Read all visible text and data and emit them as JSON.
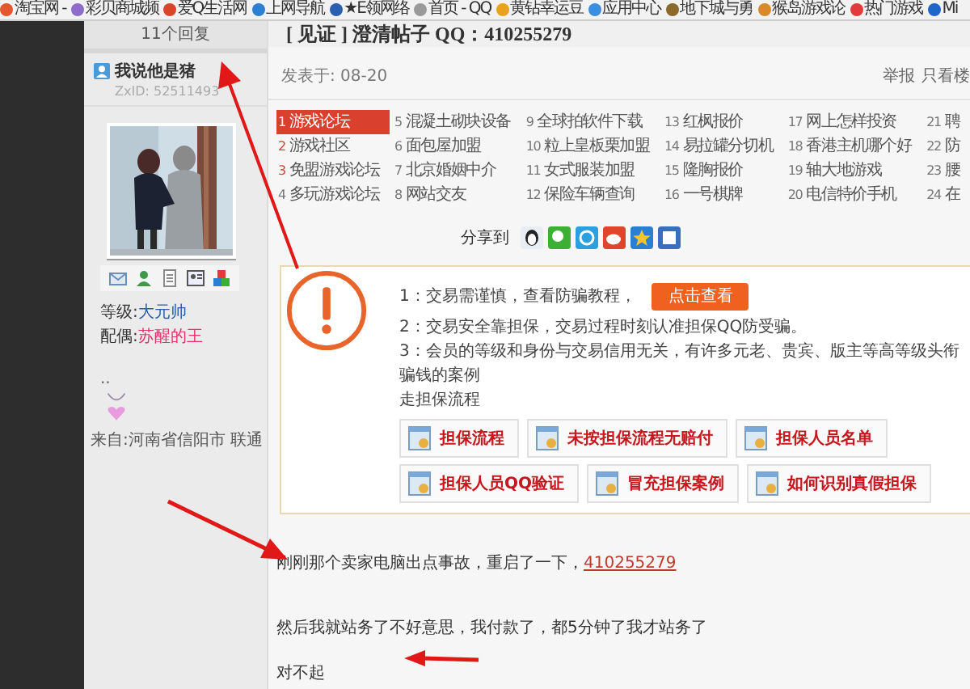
{
  "bookmarks": [
    {
      "label": "淘宝网 -",
      "color": "#e4572e"
    },
    {
      "label": "彩贝商城频",
      "color": "#8e6cc9"
    },
    {
      "label": "爱Q生活网",
      "color": "#d9452b"
    },
    {
      "label": "上网导航",
      "color": "#2d7fd3"
    },
    {
      "label": "★E领网络",
      "color": "#2b5fb0"
    },
    {
      "label": "首页 - QQ",
      "color": "#9a9a9a"
    },
    {
      "label": "黄钻幸运豆",
      "color": "#e8a21c"
    },
    {
      "label": "应用中心",
      "color": "#3a8de0"
    },
    {
      "label": "地下城与勇",
      "color": "#8a6a2a"
    },
    {
      "label": "猴岛游戏论",
      "color": "#d88a2a"
    },
    {
      "label": "热门游戏",
      "color": "#e23b3b"
    },
    {
      "label": "Mi",
      "color": "#2066c8"
    }
  ],
  "sidebar": {
    "reply_count": "11个回复",
    "username": "我说他是猪",
    "user_id": "ZxID: 52511493",
    "fields": [
      {
        "label": "等级:",
        "value": "大元帅",
        "color": "#2a5caa"
      },
      {
        "label": "配偶:",
        "value": "苏醒的王",
        "color": "#e0336f"
      }
    ],
    "signature": "..",
    "location": "来自:河南省信阳市 联通"
  },
  "post": {
    "title": "[ 见证 ] 澄清帖子  QQ：410255279",
    "posted": "发表于: 08-20",
    "actions": [
      "举报",
      "只看楼"
    ],
    "ads": [
      {
        "number": "1",
        "text": "游戏论坛",
        "selected": true,
        "hot": true
      },
      {
        "number": "2",
        "text": "游戏社区",
        "selected": false,
        "hot": true
      },
      {
        "number": "3",
        "text": "免盟游戏论坛",
        "selected": false,
        "hot": true
      },
      {
        "number": "4",
        "text": "多玩游戏论坛",
        "selected": false,
        "hot": false
      },
      {
        "number": "5",
        "text": "混凝土砌块设备",
        "selected": false,
        "hot": false
      },
      {
        "number": "6",
        "text": "面包屋加盟",
        "selected": false,
        "hot": false
      },
      {
        "number": "7",
        "text": "北京婚姻中介",
        "selected": false,
        "hot": false
      },
      {
        "number": "8",
        "text": "网站交友",
        "selected": false,
        "hot": false
      },
      {
        "number": "9",
        "text": "全球拍软件下载",
        "selected": false,
        "hot": false
      },
      {
        "number": "10",
        "text": "粒上皇板栗加盟",
        "selected": false,
        "hot": false
      },
      {
        "number": "11",
        "text": "女式服装加盟",
        "selected": false,
        "hot": false
      },
      {
        "number": "12",
        "text": "保险车辆查询",
        "selected": false,
        "hot": false
      },
      {
        "number": "13",
        "text": "红枫报价",
        "selected": false,
        "hot": false
      },
      {
        "number": "14",
        "text": "易拉罐分切机",
        "selected": false,
        "hot": false
      },
      {
        "number": "15",
        "text": "隆胸报价",
        "selected": false,
        "hot": false
      },
      {
        "number": "16",
        "text": "一号棋牌",
        "selected": false,
        "hot": false
      },
      {
        "number": "17",
        "text": "网上怎样投资",
        "selected": false,
        "hot": false
      },
      {
        "number": "18",
        "text": "香港主机哪个好",
        "selected": false,
        "hot": false
      },
      {
        "number": "19",
        "text": "轴大地游戏",
        "selected": false,
        "hot": false
      },
      {
        "number": "20",
        "text": "电信特价手机",
        "selected": false,
        "hot": false
      },
      {
        "number": "21",
        "text": "聘",
        "selected": false,
        "hot": false
      },
      {
        "number": "22",
        "text": "防",
        "selected": false,
        "hot": false
      },
      {
        "number": "23",
        "text": "腰",
        "selected": false,
        "hot": false
      },
      {
        "number": "24",
        "text": "在",
        "selected": false,
        "hot": false
      }
    ],
    "share_label": "分享到",
    "notice": {
      "lines": [
        "1：交易需谨慎，查看防骗教程，",
        "2：交易安全靠担保，交易过程时刻认准担保QQ防受骗。",
        "3：会员的等级和身份与交易信用无关，有许多元老、贵宾、版主等高等级头衔骗钱的案例",
        "走担保流程"
      ],
      "button": "点击查看",
      "links": [
        "担保流程",
        "未按担保流程无赔付",
        "担保人员名单",
        "担保人员QQ验证",
        "冒充担保案例",
        "如何识别真假担保"
      ]
    },
    "body": [
      {
        "text": "刚刚那个卖家电脑出点事故，重启了一下，",
        "link": "410255279"
      },
      {
        "text": "然后我就站务了不好意思，我付款了，都5分钟了我才站务了"
      },
      {
        "text": "对不起"
      }
    ]
  }
}
